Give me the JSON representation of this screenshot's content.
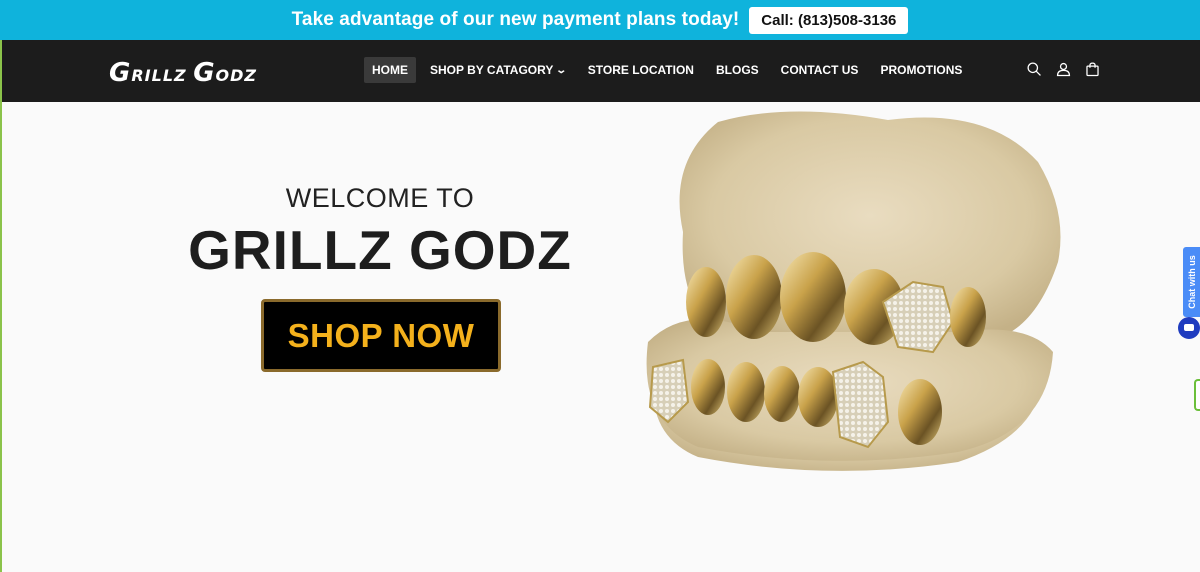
{
  "announcement": {
    "text": "Take advantage of our new payment plans today!",
    "call_button": "Call: (813)508-3136"
  },
  "header": {
    "logo_first": "G",
    "logo_rest1": "RILLZ ",
    "logo_second": "G",
    "logo_rest2": "ODZ",
    "nav": [
      {
        "label": "HOME"
      },
      {
        "label": "SHOP BY CATAGORY"
      },
      {
        "label": "STORE LOCATION"
      },
      {
        "label": "BLOGS"
      },
      {
        "label": "CONTACT US"
      },
      {
        "label": "PROMOTIONS"
      }
    ],
    "icons": [
      "search-icon",
      "account-icon",
      "cart-icon"
    ]
  },
  "hero": {
    "welcome": "WELCOME TO",
    "brand": "GRILLZ GODZ",
    "cta": "SHOP NOW"
  },
  "chat": {
    "label": "Chat with us"
  },
  "colors": {
    "announcement_bg": "#0fb3dc",
    "header_bg": "#1c1c1c",
    "cta_text": "#f4b11c",
    "chat_tab": "#4a8cf7"
  }
}
